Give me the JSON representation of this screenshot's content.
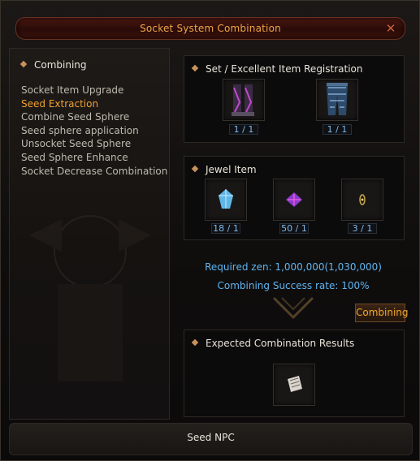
{
  "window": {
    "title": "Socket System Combination"
  },
  "left_panel": {
    "header": "Combining",
    "menu": [
      {
        "label": "Socket Item Upgrade",
        "active": false
      },
      {
        "label": "Seed Extraction",
        "active": true
      },
      {
        "label": "Combine Seed Sphere",
        "active": false
      },
      {
        "label": "Seed sphere application",
        "active": false
      },
      {
        "label": "Unsocket Seed Sphere",
        "active": false
      },
      {
        "label": "Seed Sphere Enhance",
        "active": false
      },
      {
        "label": "Socket Decrease Combination",
        "active": false
      }
    ]
  },
  "registration": {
    "header": "Set / Excellent Item Registration",
    "slots": [
      {
        "icon": "gloves-item-icon",
        "count": "1 / 1"
      },
      {
        "icon": "pants-item-icon",
        "count": "1 / 1"
      }
    ]
  },
  "jewel": {
    "header": "Jewel Item",
    "slots": [
      {
        "icon": "jewel-blue-icon",
        "count": "18 / 1"
      },
      {
        "icon": "jewel-purple-icon",
        "count": "50 / 1"
      },
      {
        "icon": "jewel-gold-icon",
        "count": "3 / 1"
      }
    ]
  },
  "requirements": {
    "zen": "Required zen: 1,000,000(1,030,000)",
    "success": "Combining Success rate: 100%"
  },
  "combine_button": "Combining",
  "results": {
    "header": "Expected Combination Results",
    "slot_icon": "scroll-item-icon"
  },
  "footer": {
    "npc": "Seed NPC"
  }
}
